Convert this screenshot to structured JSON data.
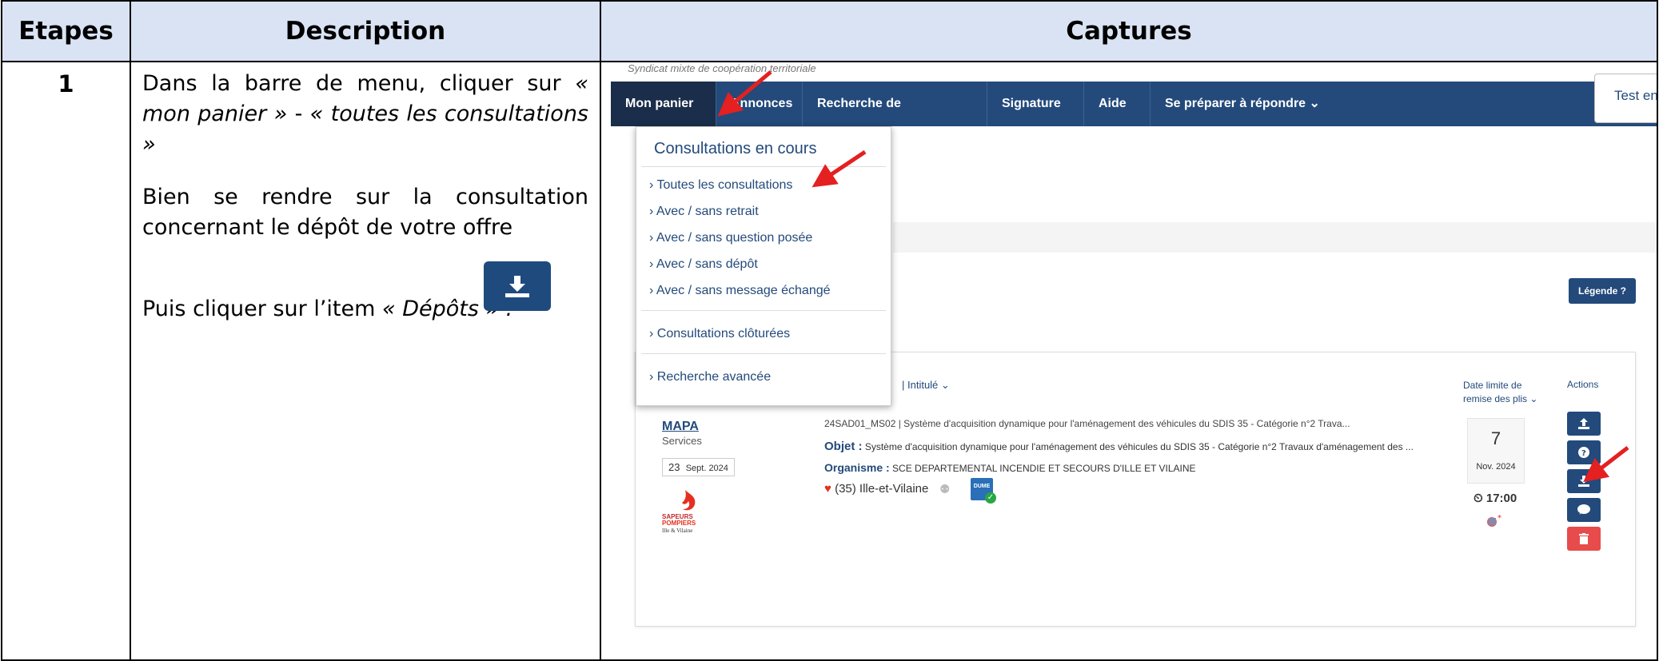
{
  "headers": {
    "steps": "Etapes",
    "description": "Description",
    "captures": "Captures"
  },
  "step_number": "1",
  "description": {
    "p1_a": "Dans la barre de menu, cliquer sur ",
    "p1_b": "« mon panier »",
    "p1_c": " - ",
    "p1_d": "« toutes les consultations »",
    "p2": "Bien se rendre sur la consultation concernant le dépôt de votre offre",
    "p3_a": "Puis cliquer sur l’item ",
    "p3_b": "« Dépôts » :",
    "icon": "download-icon"
  },
  "capture": {
    "org_subtitle": "Syndicat mixte de coopération territoriale",
    "nav": [
      "Mon panier ⌄",
      "Annonces ⌄",
      "Recherche de collaboration",
      "Signature ⌄",
      "Aide ⌄",
      "Se préparer à répondre ⌄"
    ],
    "account": "Test entreprise ... ⌄",
    "dropdown": {
      "title": "Consultations en cours",
      "items": [
        "Toutes les consultations",
        "Avec /  sans retrait",
        "Avec /  sans question posée",
        "Avec /  sans dépôt",
        "Avec /  sans message échangé"
      ],
      "closed": "Consultations clôturées",
      "advanced": "Recherche avancée"
    },
    "legend_button": "Légende ?",
    "columns": {
      "intitule": "|  Intitulé ⌄",
      "date_limit_1": "Date limite de",
      "date_limit_2": "remise des plis ⌄",
      "actions": "Actions"
    },
    "result": {
      "procedure": "MAPA",
      "category": "Services",
      "pub_day": "23",
      "pub_month_year": "Sept. 2024",
      "logo_text_1": "SAPEURS",
      "logo_text_2": "POMPIERS",
      "logo_text_3": "Ille & Vilaine",
      "reference": "24SAD01_MS02  |  Système d'acquisition dynamique pour l'aménagement des véhicules du SDIS 35 - Catégorie n°2 Trava...",
      "objet_label": "Objet :",
      "objet": "Système d'acquisition dynamique pour l'aménagement des véhicules du SDIS 35 - Catégorie n°2 Travaux d'aménagement des ...",
      "organisme_label": "Organisme :",
      "organisme": "SCE DEPARTEMENTAL INCENDIE ET SECOURS D'ILLE ET VILAINE",
      "location": "(35) Ille-et-Vilaine",
      "dume": "DUME",
      "deadline_day": "7",
      "deadline_month_year": "Nov.  2024",
      "deadline_time": "17:00"
    }
  }
}
